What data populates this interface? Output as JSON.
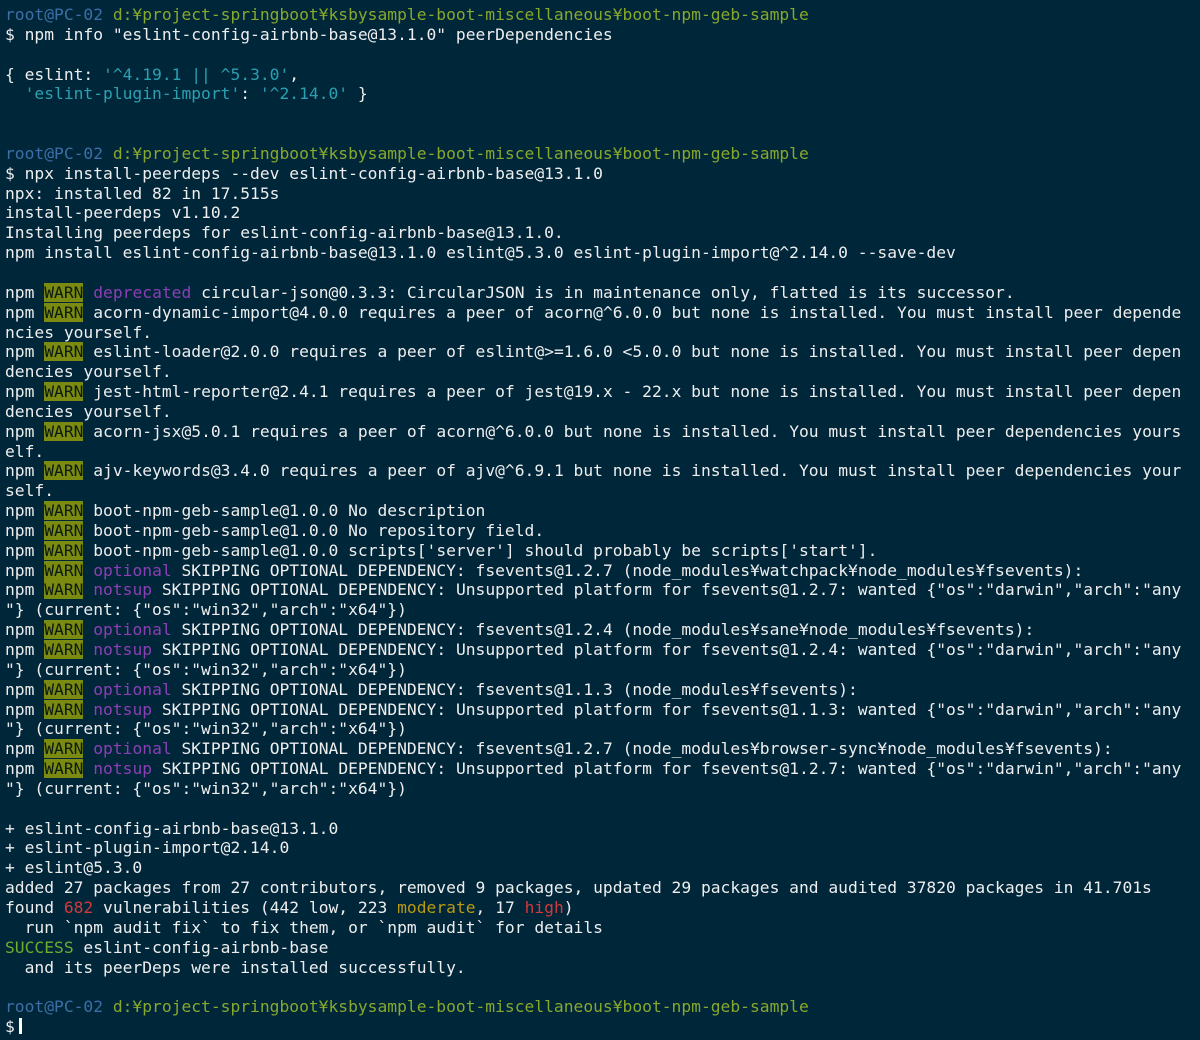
{
  "window": {
    "colors": {
      "background": "#00263a",
      "text": "#eeeeee",
      "prompt_user": "#3c6fa5",
      "prompt_path": "#88a82b",
      "string": "#2aa1b3",
      "warn_bg": "#7b8a10",
      "deprecated": "#8c3fb5",
      "high": "#d03a3a",
      "moderate": "#b99a10",
      "success": "#6dae2e"
    }
  },
  "terminal": {
    "cursor_icon": "block-cursor-icon",
    "lines": [
      [
        {
          "t": "root@PC-02 ",
          "c": "user"
        },
        {
          "t": "d:¥project-springboot¥ksbysample-boot-miscellaneous¥boot-npm-geb-sample",
          "c": "path"
        }
      ],
      [
        {
          "t": "$ npm info \"eslint-config-airbnb-base@13.1.0\" peerDependencies"
        }
      ],
      [],
      [
        {
          "t": "{ eslint: "
        },
        {
          "t": "'^4.19.1 || ^5.3.0'",
          "c": "cyan"
        },
        {
          "t": ","
        }
      ],
      [
        {
          "t": "  "
        },
        {
          "t": "'eslint-plugin-import'",
          "c": "cyan"
        },
        {
          "t": ": "
        },
        {
          "t": "'^2.14.0'",
          "c": "cyan"
        },
        {
          "t": " }"
        }
      ],
      [],
      [],
      [
        {
          "t": "root@PC-02 ",
          "c": "user"
        },
        {
          "t": "d:¥project-springboot¥ksbysample-boot-miscellaneous¥boot-npm-geb-sample",
          "c": "path"
        }
      ],
      [
        {
          "t": "$ npx install-peerdeps --dev eslint-config-airbnb-base@13.1.0"
        }
      ],
      [
        {
          "t": "npx: installed 82 in 17.515s"
        }
      ],
      [
        {
          "t": "install-peerdeps v1.10.2"
        }
      ],
      [
        {
          "t": "Installing peerdeps for eslint-config-airbnb-base@13.1.0."
        }
      ],
      [
        {
          "t": "npm install eslint-config-airbnb-base@13.1.0 eslint@5.3.0 eslint-plugin-import@^2.14.0 --save-dev"
        }
      ],
      [],
      [
        {
          "t": "npm "
        },
        {
          "t": "WARN",
          "c": "warn"
        },
        {
          "t": " "
        },
        {
          "t": "deprecated",
          "c": "magenta"
        },
        {
          "t": " circular-json@0.3.3: CircularJSON is in maintenance only, flatted is its successor."
        }
      ],
      [
        {
          "t": "npm "
        },
        {
          "t": "WARN",
          "c": "warn"
        },
        {
          "t": " acorn-dynamic-import@4.0.0 requires a peer of acorn@^6.0.0 but none is installed. You must install peer depende"
        }
      ],
      [
        {
          "t": "ncies yourself."
        }
      ],
      [
        {
          "t": "npm "
        },
        {
          "t": "WARN",
          "c": "warn"
        },
        {
          "t": " eslint-loader@2.0.0 requires a peer of eslint@>=1.6.0 <5.0.0 but none is installed. You must install peer depen"
        }
      ],
      [
        {
          "t": "dencies yourself."
        }
      ],
      [
        {
          "t": "npm "
        },
        {
          "t": "WARN",
          "c": "warn"
        },
        {
          "t": " jest-html-reporter@2.4.1 requires a peer of jest@19.x - 22.x but none is installed. You must install peer depen"
        }
      ],
      [
        {
          "t": "dencies yourself."
        }
      ],
      [
        {
          "t": "npm "
        },
        {
          "t": "WARN",
          "c": "warn"
        },
        {
          "t": " acorn-jsx@5.0.1 requires a peer of acorn@^6.0.0 but none is installed. You must install peer dependencies yours"
        }
      ],
      [
        {
          "t": "elf."
        }
      ],
      [
        {
          "t": "npm "
        },
        {
          "t": "WARN",
          "c": "warn"
        },
        {
          "t": " ajv-keywords@3.4.0 requires a peer of ajv@^6.9.1 but none is installed. You must install peer dependencies your"
        }
      ],
      [
        {
          "t": "self."
        }
      ],
      [
        {
          "t": "npm "
        },
        {
          "t": "WARN",
          "c": "warn"
        },
        {
          "t": " boot-npm-geb-sample@1.0.0 No description"
        }
      ],
      [
        {
          "t": "npm "
        },
        {
          "t": "WARN",
          "c": "warn"
        },
        {
          "t": " boot-npm-geb-sample@1.0.0 No repository field."
        }
      ],
      [
        {
          "t": "npm "
        },
        {
          "t": "WARN",
          "c": "warn"
        },
        {
          "t": " boot-npm-geb-sample@1.0.0 scripts['server'] should probably be scripts['start']."
        }
      ],
      [
        {
          "t": "npm "
        },
        {
          "t": "WARN",
          "c": "warn"
        },
        {
          "t": " "
        },
        {
          "t": "optional",
          "c": "magenta"
        },
        {
          "t": " SKIPPING OPTIONAL DEPENDENCY: fsevents@1.2.7 (node_modules¥watchpack¥node_modules¥fsevents):"
        }
      ],
      [
        {
          "t": "npm "
        },
        {
          "t": "WARN",
          "c": "warn"
        },
        {
          "t": " "
        },
        {
          "t": "notsup",
          "c": "magenta"
        },
        {
          "t": " SKIPPING OPTIONAL DEPENDENCY: Unsupported platform for fsevents@1.2.7: wanted {\"os\":\"darwin\",\"arch\":\"any"
        }
      ],
      [
        {
          "t": "\"} (current: {\"os\":\"win32\",\"arch\":\"x64\"})"
        }
      ],
      [
        {
          "t": "npm "
        },
        {
          "t": "WARN",
          "c": "warn"
        },
        {
          "t": " "
        },
        {
          "t": "optional",
          "c": "magenta"
        },
        {
          "t": " SKIPPING OPTIONAL DEPENDENCY: fsevents@1.2.4 (node_modules¥sane¥node_modules¥fsevents):"
        }
      ],
      [
        {
          "t": "npm "
        },
        {
          "t": "WARN",
          "c": "warn"
        },
        {
          "t": " "
        },
        {
          "t": "notsup",
          "c": "magenta"
        },
        {
          "t": " SKIPPING OPTIONAL DEPENDENCY: Unsupported platform for fsevents@1.2.4: wanted {\"os\":\"darwin\",\"arch\":\"any"
        }
      ],
      [
        {
          "t": "\"} (current: {\"os\":\"win32\",\"arch\":\"x64\"})"
        }
      ],
      [
        {
          "t": "npm "
        },
        {
          "t": "WARN",
          "c": "warn"
        },
        {
          "t": " "
        },
        {
          "t": "optional",
          "c": "magenta"
        },
        {
          "t": " SKIPPING OPTIONAL DEPENDENCY: fsevents@1.1.3 (node_modules¥fsevents):"
        }
      ],
      [
        {
          "t": "npm "
        },
        {
          "t": "WARN",
          "c": "warn"
        },
        {
          "t": " "
        },
        {
          "t": "notsup",
          "c": "magenta"
        },
        {
          "t": " SKIPPING OPTIONAL DEPENDENCY: Unsupported platform for fsevents@1.1.3: wanted {\"os\":\"darwin\",\"arch\":\"any"
        }
      ],
      [
        {
          "t": "\"} (current: {\"os\":\"win32\",\"arch\":\"x64\"})"
        }
      ],
      [
        {
          "t": "npm "
        },
        {
          "t": "WARN",
          "c": "warn"
        },
        {
          "t": " "
        },
        {
          "t": "optional",
          "c": "magenta"
        },
        {
          "t": " SKIPPING OPTIONAL DEPENDENCY: fsevents@1.2.7 (node_modules¥browser-sync¥node_modules¥fsevents):"
        }
      ],
      [
        {
          "t": "npm "
        },
        {
          "t": "WARN",
          "c": "warn"
        },
        {
          "t": " "
        },
        {
          "t": "notsup",
          "c": "magenta"
        },
        {
          "t": " SKIPPING OPTIONAL DEPENDENCY: Unsupported platform for fsevents@1.2.7: wanted {\"os\":\"darwin\",\"arch\":\"any"
        }
      ],
      [
        {
          "t": "\"} (current: {\"os\":\"win32\",\"arch\":\"x64\"})"
        }
      ],
      [],
      [
        {
          "t": "+ eslint-config-airbnb-base@13.1.0"
        }
      ],
      [
        {
          "t": "+ eslint-plugin-import@2.14.0"
        }
      ],
      [
        {
          "t": "+ eslint@5.3.0"
        }
      ],
      [
        {
          "t": "added 27 packages from 27 contributors, removed 9 packages, updated 29 packages and audited 37820 packages in 41.701s"
        }
      ],
      [
        {
          "t": "found "
        },
        {
          "t": "682",
          "c": "red"
        },
        {
          "t": " vulnerabilities (442 low, 223 "
        },
        {
          "t": "moderate",
          "c": "yellow"
        },
        {
          "t": ", 17 "
        },
        {
          "t": "high",
          "c": "red"
        },
        {
          "t": ")"
        }
      ],
      [
        {
          "t": "  run `npm audit fix` to fix them, or `npm audit` for details"
        }
      ],
      [
        {
          "t": "SUCCESS",
          "c": "green"
        },
        {
          "t": " eslint-config-airbnb-base"
        }
      ],
      [
        {
          "t": "  and its peerDeps were installed successfully."
        }
      ],
      [],
      [
        {
          "t": "root@PC-02 ",
          "c": "user"
        },
        {
          "t": "d:¥project-springboot¥ksbysample-boot-miscellaneous¥boot-npm-geb-sample",
          "c": "path"
        }
      ],
      [
        {
          "t": "$"
        }
      ]
    ]
  }
}
